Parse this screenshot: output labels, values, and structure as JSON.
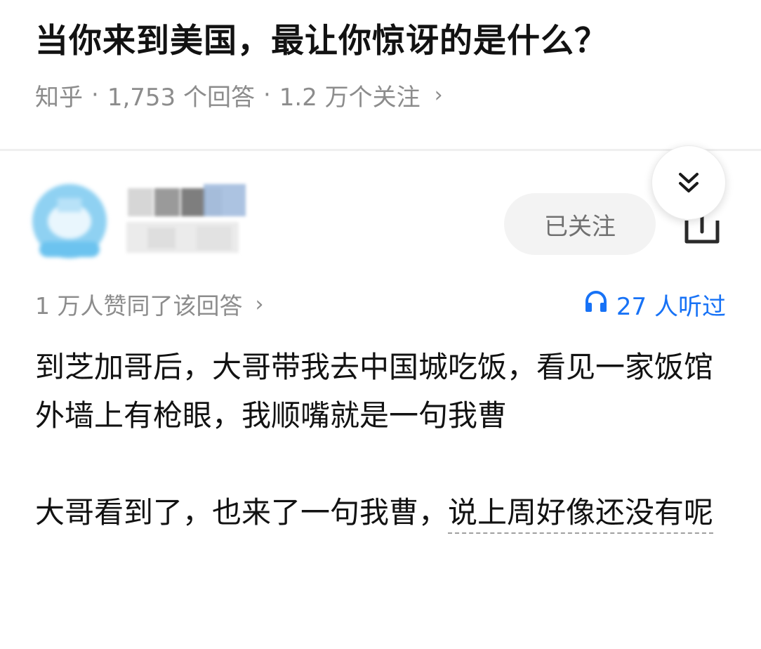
{
  "question": {
    "title": "当你来到美国，最让你惊讶的是什么？",
    "source": "知乎",
    "separator": "·",
    "answer_count": "1,753 个回答",
    "follower_count": "1.2 万个关注",
    "chevron": "›"
  },
  "author": {
    "avatar_icon": "blurred-avatar",
    "follow_label": "已关注",
    "share_icon": "share-icon",
    "collapse_icon": "double-chevron-down-icon"
  },
  "answer": {
    "upvote_text": "1 万人赞同了该回答",
    "chevron": "›",
    "listen_icon": "headphones-icon",
    "listen_text": "27 人听过",
    "accent_color": "#1772f6",
    "paragraph1": "到芝加哥后，大哥带我去中国城吃饭，看见一家饭馆外墙上有枪眼，我顺嘴就是一句我曹",
    "paragraph2_a": "大哥看到了，也来了一句我曹，",
    "paragraph2_b": "说上周好像还没有呢"
  }
}
